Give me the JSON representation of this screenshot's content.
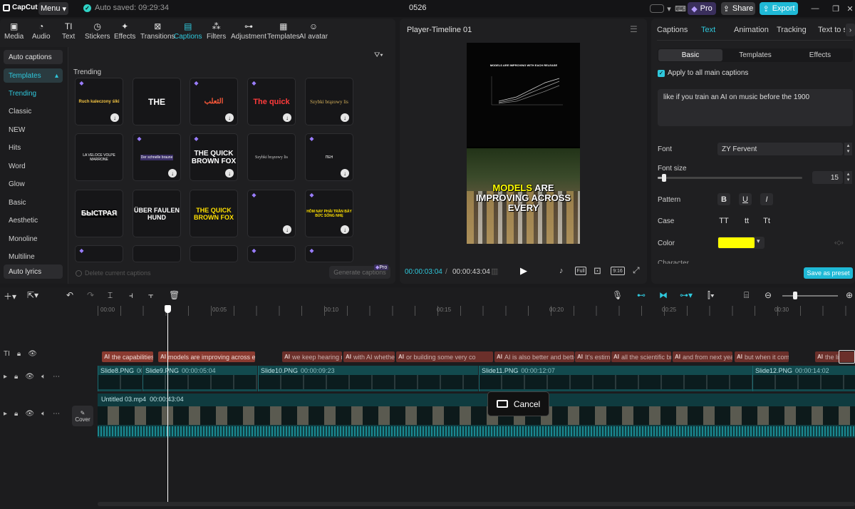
{
  "app": {
    "logo": "CapCut",
    "menu": "Menu",
    "autosave": "Auto saved: 09:29:34",
    "project": "0526",
    "pro": "Pro",
    "share": "Share",
    "export": "Export"
  },
  "toolbar": {
    "items": [
      {
        "label": "Media",
        "icon": "media-icon"
      },
      {
        "label": "Audio",
        "icon": "audio-icon"
      },
      {
        "label": "Text",
        "icon": "text-icon"
      },
      {
        "label": "Stickers",
        "icon": "stickers-icon"
      },
      {
        "label": "Effects",
        "icon": "effects-icon"
      },
      {
        "label": "Transitions",
        "icon": "transitions-icon"
      },
      {
        "label": "Captions",
        "icon": "captions-icon"
      },
      {
        "label": "Filters",
        "icon": "filters-icon"
      },
      {
        "label": "Adjustment",
        "icon": "adjustment-icon"
      },
      {
        "label": "Templates",
        "icon": "templates-icon"
      },
      {
        "label": "AI avatar",
        "icon": "ai-avatar-icon"
      }
    ],
    "active": "Captions"
  },
  "sidebar": {
    "auto_captions": "Auto captions",
    "templates": "Templates",
    "items": [
      "Trending",
      "Classic",
      "NEW",
      "Hits",
      "Word",
      "Glow",
      "Basic",
      "Aesthetic",
      "Monoline",
      "Multiline"
    ],
    "auto_lyrics": "Auto lyrics"
  },
  "gallery": {
    "heading": "Trending",
    "cards": [
      "Ruch kaleczony ślki",
      "THE",
      "الثعلب",
      "The quick",
      "Szybki brązowy lis",
      "LA VELOCE VOLPE MARRONE",
      "Der schnelle braune",
      "THE QUICK BROWN FOX",
      "Szybki brązowy lis",
      "ПЕН",
      "БЫСТРАЯ",
      "ÜBER FAULEN HUND",
      "THE QUICK BROWN FOX",
      "",
      "HÔM NAY PHẢI TRẦN BẢY BỨC SỐNG NHẸ"
    ],
    "delete_label": "Delete current captions",
    "generate_label": "Generate captions",
    "pro_badge": "Pro"
  },
  "player": {
    "title": "Player-Timeline 01",
    "current_time": "00:00:03:04",
    "total_time": "00:00:43:04",
    "chart_title": "MODELS ARE IMPROVING WITH EACH RELEASE",
    "caption_line1_a": "MODELS",
    "caption_line1_b": "ARE",
    "caption_line2": "IMPROVING ACROSS",
    "caption_line3": "EVERY",
    "full": "Full",
    "ratio": "9:16"
  },
  "right_panel": {
    "tabs": [
      "Captions",
      "Text",
      "Animation",
      "Tracking",
      "Text to s"
    ],
    "active_tab": "Text",
    "subtabs": [
      "Basic",
      "Templates",
      "Effects"
    ],
    "apply_all": "Apply to all main captions",
    "text_value": "like if you train an AI on music before the 1900",
    "font_label": "Font",
    "font_value": "ZY Fervent",
    "font_size_label": "Font size",
    "font_size_value": "15",
    "font_size_fraction": 0.03,
    "pattern_label": "Pattern",
    "pattern_b": "B",
    "pattern_u": "U",
    "pattern_i": "I",
    "case_label": "Case",
    "case_options": [
      "TT",
      "tt",
      "Tt"
    ],
    "color_label": "Color",
    "color_value": "#ffff00",
    "character_label": "Character",
    "save_preset": "Save as preset"
  },
  "timeline": {
    "ruler": [
      "00:00",
      "00:05",
      "00:10",
      "00:15",
      "00:20",
      "00:25",
      "00:30"
    ],
    "captions": [
      "the capabilities",
      "models are improving across eve",
      "we keep hearing m",
      "with AI whethe",
      "or building some very co",
      "AI is also better and bette",
      "It's estim",
      "all the scientific br",
      "and from next year",
      "but when it com",
      "the li"
    ],
    "slides": [
      {
        "label": "Slide8.PNG",
        "dur": "00"
      },
      {
        "label": "Slide9.PNG",
        "dur": "00:00:05:04"
      },
      {
        "label": "Slide10.PNG",
        "dur": "00:00:09:23"
      },
      {
        "label": "Slide11.PNG",
        "dur": "00:00:12:07"
      },
      {
        "label": "Slide12.PNG",
        "dur": "00:00:14:02"
      }
    ],
    "video": {
      "label": "Untitled 03.mp4",
      "dur": "00:00:43:04"
    },
    "cover": "Cover",
    "cancel": "Cancel"
  },
  "colors": {
    "accent": "#2fc8dc",
    "export": "#1fb9d6",
    "caption_clip": "#6b2f2a",
    "video_clip": "#124a4e",
    "pro": "#7b5cff"
  }
}
